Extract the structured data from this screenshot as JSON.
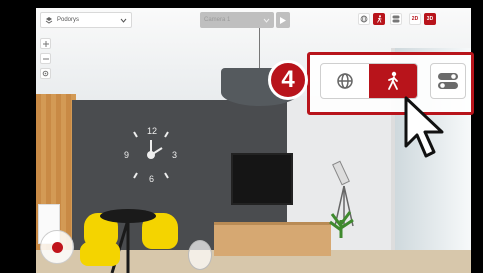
{
  "toolbar": {
    "floor_select_label": "Podorys",
    "camera_select_label": "Camera 1",
    "view_2d": "2D",
    "view_3d": "3D"
  },
  "callout": {
    "step_number": "4"
  },
  "icons": {
    "floor": "layers-icon",
    "dropdown": "chevron-down-icon",
    "play": "play-icon",
    "orbit": "orbit-icon",
    "walk": "walk-person-icon",
    "settings_toggle": "toggle-icon",
    "cursor": "pointer-cursor-icon",
    "record": "record-icon"
  },
  "colors": {
    "accent": "#b8141b",
    "accent_text": "#ffffff"
  }
}
